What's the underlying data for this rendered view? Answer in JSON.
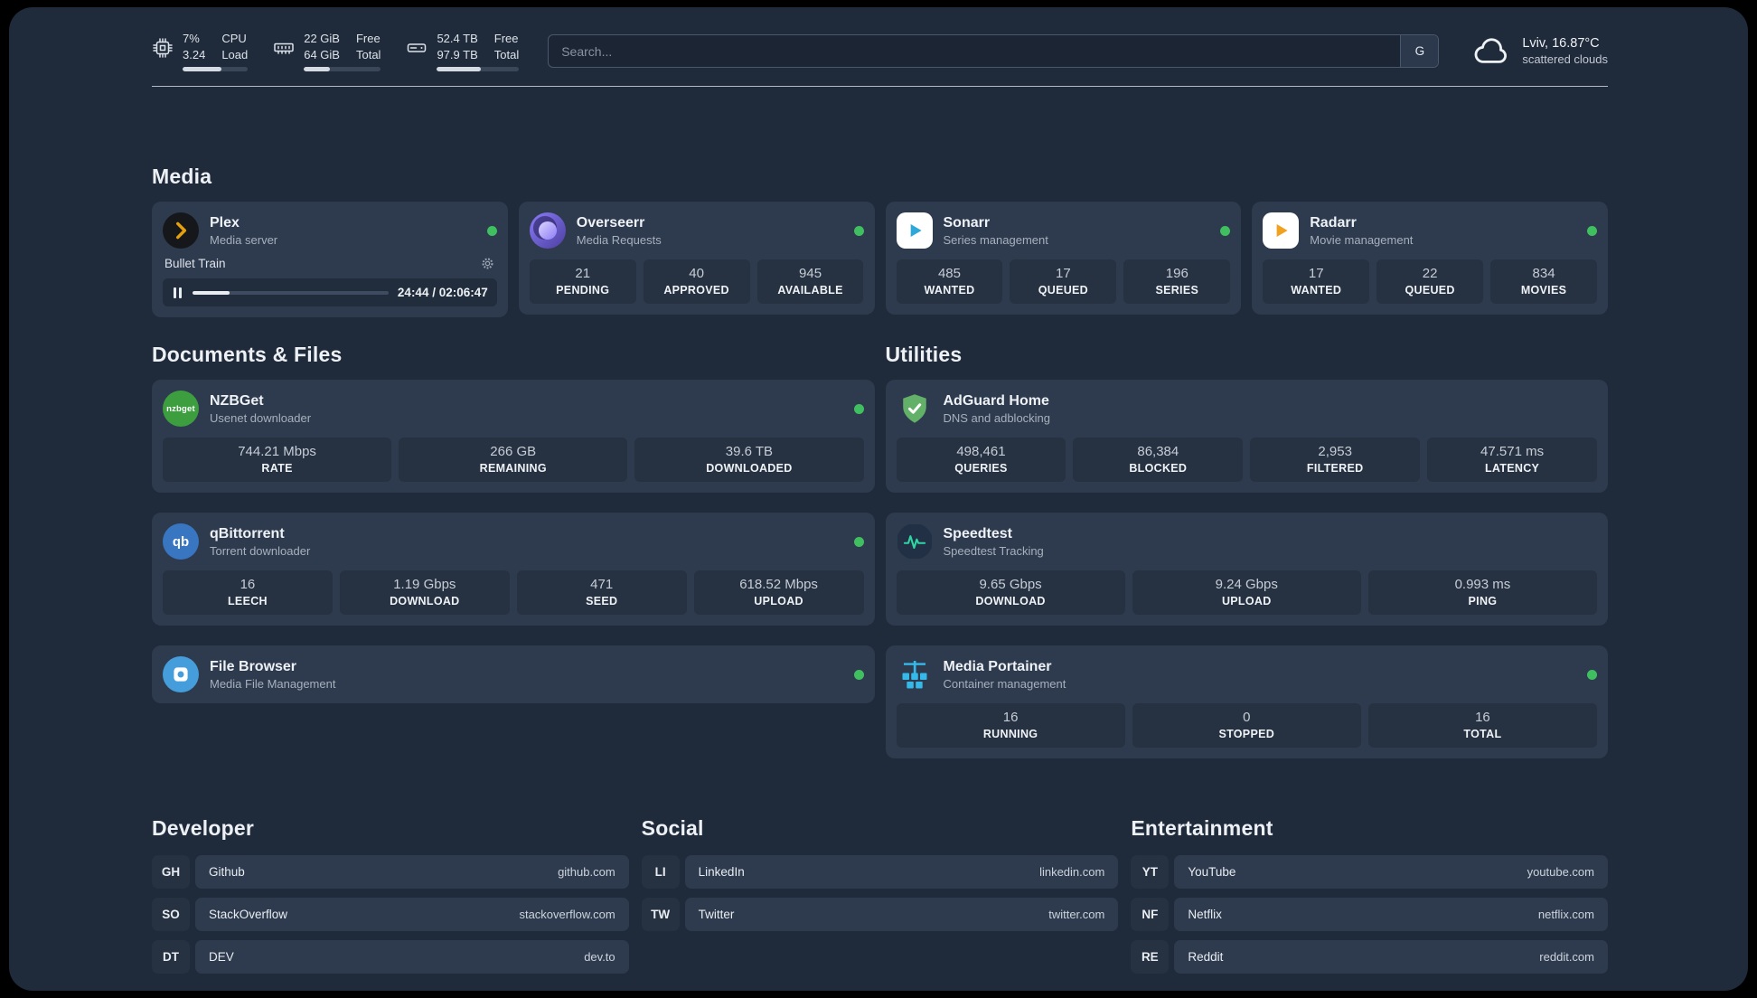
{
  "colors": {
    "background": "#1f2a3a",
    "card": "#2e3b4e",
    "tile": "#263142",
    "status_online": "#3fbf5f",
    "plex_gold": "#e5a00d",
    "sonarr_blue": "#2da8d8",
    "radarr_orange": "#f0a11e",
    "nzbget_green": "#3c9e3f",
    "qbittorrent_blue": "#3876c2",
    "filebrowser_blue": "#459ddb",
    "adguard_green": "#63b168",
    "speedtest_green": "#2fd6a3",
    "portainer_blue": "#35b9e9"
  },
  "topbar": {
    "cpu": {
      "icon": "cpu-chip-icon",
      "value_top": "7%",
      "value_bottom": "3.24",
      "label_top": "CPU",
      "label_bottom": "Load",
      "progress_pct": 60
    },
    "memory": {
      "icon": "ram-icon",
      "value_top": "22 GiB",
      "value_bottom": "64 GiB",
      "label_top": "Free",
      "label_bottom": "Total",
      "progress_pct": 34
    },
    "storage": {
      "icon": "hard-drive-icon",
      "value_top": "52.4 TB",
      "value_bottom": "97.9 TB",
      "label_top": "Free",
      "label_bottom": "Total",
      "progress_pct": 54
    },
    "search": {
      "placeholder": "Search...",
      "engine_label": "G"
    },
    "weather": {
      "icon": "cloud-icon",
      "location": "Lviv, 16.87°C",
      "condition": "scattered clouds"
    }
  },
  "sections": {
    "media": {
      "title": "Media",
      "plex": {
        "icon": "plex-chevron-icon",
        "name": "Plex",
        "subtitle": "Media server",
        "online": true,
        "player": {
          "title": "Bullet Train",
          "time": "24:44 / 02:06:47",
          "progress_pct": 19
        }
      },
      "overseerr": {
        "icon": "overseerr-swirl-icon",
        "name": "Overseerr",
        "subtitle": "Media Requests",
        "online": true,
        "stats": [
          {
            "value": "21",
            "label": "PENDING"
          },
          {
            "value": "40",
            "label": "APPROVED"
          },
          {
            "value": "945",
            "label": "AVAILABLE"
          }
        ]
      },
      "sonarr": {
        "icon": "play-triangle-icon",
        "name": "Sonarr",
        "subtitle": "Series management",
        "online": true,
        "stats": [
          {
            "value": "485",
            "label": "WANTED"
          },
          {
            "value": "17",
            "label": "QUEUED"
          },
          {
            "value": "196",
            "label": "SERIES"
          }
        ]
      },
      "radarr": {
        "icon": "play-triangle-icon",
        "name": "Radarr",
        "subtitle": "Movie management",
        "online": true,
        "stats": [
          {
            "value": "17",
            "label": "WANTED"
          },
          {
            "value": "22",
            "label": "QUEUED"
          },
          {
            "value": "834",
            "label": "MOVIES"
          }
        ]
      }
    },
    "documents": {
      "title": "Documents & Files",
      "nzbget": {
        "icon": "nzbget-badge-icon",
        "name": "NZBGet",
        "subtitle": "Usenet downloader",
        "online": true,
        "stats": [
          {
            "value": "744.21 Mbps",
            "label": "RATE"
          },
          {
            "value": "266 GB",
            "label": "REMAINING"
          },
          {
            "value": "39.6 TB",
            "label": "DOWNLOADED"
          }
        ]
      },
      "qbittorrent": {
        "icon": "qb-badge-icon",
        "name": "qBittorrent",
        "subtitle": "Torrent downloader",
        "online": true,
        "stats": [
          {
            "value": "16",
            "label": "LEECH"
          },
          {
            "value": "1.19 Gbps",
            "label": "DOWNLOAD"
          },
          {
            "value": "471",
            "label": "SEED"
          },
          {
            "value": "618.52 Mbps",
            "label": "UPLOAD"
          }
        ]
      },
      "filebrowser": {
        "icon": "filebrowser-icon",
        "name": "File Browser",
        "subtitle": "Media File Management",
        "online": true
      }
    },
    "utilities": {
      "title": "Utilities",
      "adguard": {
        "icon": "shield-check-icon",
        "name": "AdGuard Home",
        "subtitle": "DNS and adblocking",
        "stats": [
          {
            "value": "498,461",
            "label": "QUERIES"
          },
          {
            "value": "86,384",
            "label": "BLOCKED"
          },
          {
            "value": "2,953",
            "label": "FILTERED"
          },
          {
            "value": "47.571 ms",
            "label": "LATENCY"
          }
        ]
      },
      "speedtest": {
        "icon": "pulse-line-icon",
        "name": "Speedtest",
        "subtitle": "Speedtest Tracking",
        "stats": [
          {
            "value": "9.65 Gbps",
            "label": "DOWNLOAD"
          },
          {
            "value": "9.24 Gbps",
            "label": "UPLOAD"
          },
          {
            "value": "0.993 ms",
            "label": "PING"
          }
        ]
      },
      "portainer": {
        "icon": "container-crane-icon",
        "name": "Media Portainer",
        "subtitle": "Container management",
        "online": true,
        "stats": [
          {
            "value": "16",
            "label": "RUNNING"
          },
          {
            "value": "0",
            "label": "STOPPED"
          },
          {
            "value": "16",
            "label": "TOTAL"
          }
        ]
      }
    }
  },
  "bookmarks": {
    "developer": {
      "title": "Developer",
      "items": [
        {
          "abbr": "GH",
          "name": "Github",
          "url": "github.com"
        },
        {
          "abbr": "SO",
          "name": "StackOverflow",
          "url": "stackoverflow.com"
        },
        {
          "abbr": "DT",
          "name": "DEV",
          "url": "dev.to"
        }
      ]
    },
    "social": {
      "title": "Social",
      "items": [
        {
          "abbr": "LI",
          "name": "LinkedIn",
          "url": "linkedin.com"
        },
        {
          "abbr": "TW",
          "name": "Twitter",
          "url": "twitter.com"
        }
      ]
    },
    "entertainment": {
      "title": "Entertainment",
      "items": [
        {
          "abbr": "YT",
          "name": "YouTube",
          "url": "youtube.com"
        },
        {
          "abbr": "NF",
          "name": "Netflix",
          "url": "netflix.com"
        },
        {
          "abbr": "RE",
          "name": "Reddit",
          "url": "reddit.com"
        }
      ]
    }
  }
}
